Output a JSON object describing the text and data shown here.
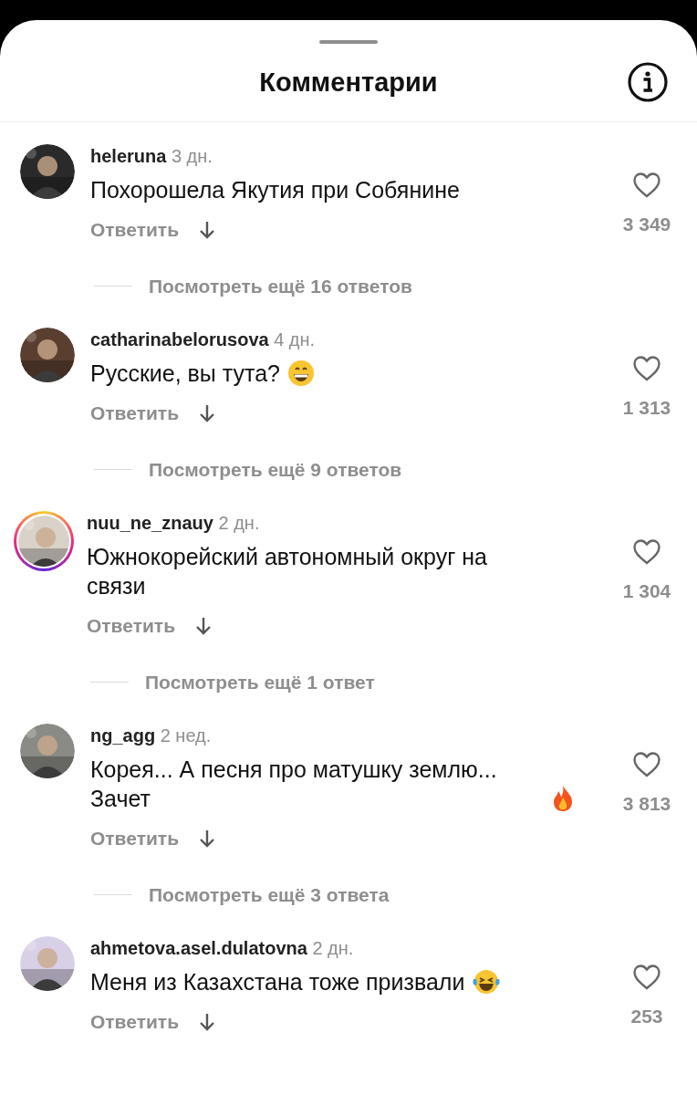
{
  "header": {
    "title": "Комментарии"
  },
  "comments": [
    {
      "user": "heleruna",
      "time": "3 дн.",
      "text": "Похорошела Якутия при Собянине",
      "story": false,
      "reply": "Ответить",
      "likes": "3 349",
      "more": "Посмотреть ещё 16 ответов"
    },
    {
      "user": "catharinabelorusova",
      "time": "4 дн.",
      "text": "Русские, вы тута?",
      "emoji": {
        "kind": "grin"
      },
      "story": false,
      "reply": "Ответить",
      "likes": "1 313",
      "more": "Посмотреть ещё 9 ответов"
    },
    {
      "user": "nuu_ne_znauy",
      "time": "2 дн.",
      "text": "Южнокорейский автономный округ на связи",
      "story": true,
      "reply": "Ответить",
      "likes": "1 304",
      "more": "Посмотреть ещё 1 ответ"
    },
    {
      "user": "ng_agg",
      "time": "2 нед.",
      "text": "Корея... А песня про матушку землю... Зачет",
      "emoji": {
        "kind": "fire"
      },
      "story": false,
      "reply": "Ответить",
      "likes": "3 813",
      "more": "Посмотреть ещё 3 ответа"
    },
    {
      "user": "ahmetova.asel.dulatovna",
      "time": "2 дн.",
      "text": "Меня из Казахстана тоже призвали",
      "emoji": {
        "kind": "joy"
      },
      "story": false,
      "reply": "Ответить",
      "likes": "253"
    }
  ]
}
